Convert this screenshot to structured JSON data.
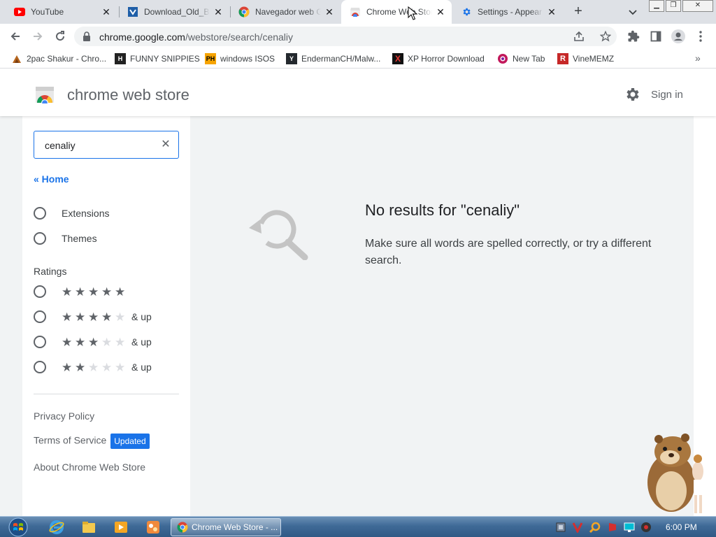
{
  "browser": {
    "tabs": [
      {
        "title": "YouTube",
        "icon": "youtube-icon",
        "active": false
      },
      {
        "title": "Download_Old_Bu",
        "icon": "download-site-icon",
        "active": false
      },
      {
        "title": "Navegador web G",
        "icon": "chrome-icon",
        "active": false
      },
      {
        "title": "Chrome Web Stor",
        "icon": "webstore-icon",
        "active": true
      },
      {
        "title": "Settings - Appear",
        "icon": "settings-gear-icon",
        "active": false
      }
    ],
    "url": {
      "host": "chrome.google.com",
      "path": "/webstore/search/cenaliy"
    },
    "bookmarks": [
      {
        "label": "2pac Shakur - Chro...",
        "icon": "profile-bookmark-icon"
      },
      {
        "label": "FUNNY SNIPPIES",
        "icon": "h-logo-icon"
      },
      {
        "label": "windows ISOS",
        "icon": "ph-logo-icon"
      },
      {
        "label": "EndermanCH/Malw...",
        "icon": "github-icon"
      },
      {
        "label": "XP Horror Download",
        "icon": "x-logo-icon"
      },
      {
        "label": "New Tab",
        "icon": "globe-icon"
      },
      {
        "label": "VineMEMZ",
        "icon": "r-logo-icon"
      }
    ],
    "bookmark_more": "»"
  },
  "store": {
    "title": "chrome web store",
    "sign_in": "Sign in",
    "search": {
      "value": "cenaliy"
    },
    "home_link": "« Home",
    "categories": [
      "Extensions",
      "Themes"
    ],
    "ratings_heading": "Ratings",
    "ratings": [
      {
        "stars": 5,
        "suffix": ""
      },
      {
        "stars": 4,
        "suffix": "& up"
      },
      {
        "stars": 3,
        "suffix": "& up"
      },
      {
        "stars": 2,
        "suffix": "& up"
      }
    ],
    "footer": {
      "privacy": "Privacy Policy",
      "terms": "Terms of Service",
      "updated_badge": "Updated",
      "about": "About Chrome Web Store"
    },
    "no_results": {
      "title": "No results for \"cenaliy\"",
      "message": "Make sure all words are spelled correctly, or try a different search."
    }
  },
  "taskbar": {
    "active_task": "Chrome Web Store - ...",
    "clock": "6:00 PM"
  },
  "colors": {
    "accent": "#1a73e8",
    "tab_strip": "#dee1e6",
    "results_bg": "#f1f3f4",
    "taskbar": "#3f6a97"
  }
}
